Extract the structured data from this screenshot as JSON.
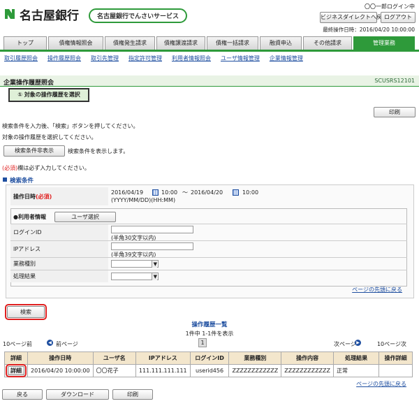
{
  "header": {
    "bank_name": "名古屋銀行",
    "service_name": "名古屋銀行でんさいサービス",
    "user_status": "〇〇一郎ログイン中",
    "direct_button": "ビジネスダイレクトへ戻る",
    "logout_button": "ログアウト",
    "last_operation": "最終操作日時：2016/04/20 10:00:00"
  },
  "tabs": [
    "トップ",
    "債権情報照会",
    "債権発生請求",
    "債権譲渡請求",
    "債権一括請求",
    "融資申込",
    "その他請求",
    "管理業務"
  ],
  "subnav": [
    "取引履歴照会",
    "操作履歴照会",
    "取引先管理",
    "指定許可管理",
    "利用者情報照会",
    "ユーザ情報管理",
    "企業情報管理"
  ],
  "page": {
    "title": "企業操作履歴照会",
    "screen_id": "SCUSRS12101",
    "step": "① 対象の操作履歴を選択",
    "print_label": "印刷",
    "instruction1": "検索条件を入力後、「検索」ボタンを押してください。",
    "instruction2": "対象の操作履歴を選択してください。",
    "toggle_button": "検索条件非表示",
    "toggle_note": "検索条件を表示します。",
    "required_marker": "(必須)",
    "required_note": "欄は必ず入力してください。"
  },
  "search": {
    "section_title": "検索条件",
    "datetime_label": "操作日時",
    "required": "(必須)",
    "from_date": "2016/04/19",
    "from_time": "10:00",
    "tilde": "〜",
    "to_date": "2016/04/20",
    "to_time": "10:00",
    "format_hint": "(YYYY/MM/DD)(HH:MM)",
    "user_info_label": "●利用者情報",
    "user_select_button": "ユーザ選択",
    "login_id_label": "ログインID",
    "login_id_hint": "(半角30文字以内)",
    "ip_label": "IPアドレス",
    "ip_hint": "(半角39文字以内)",
    "business_type_label": "業務種別",
    "result_label": "処理結果",
    "page_top_link": "ページの先頭に戻る",
    "search_button": "検索"
  },
  "results": {
    "title": "操作履歴一覧",
    "count_text": "1件中 1-1件を表示",
    "prev10": "10ページ前",
    "prev": "前ページ",
    "page_num": "1",
    "next": "次ページ",
    "next10": "10ページ次",
    "columns": [
      "詳細",
      "操作日時",
      "ユーザ名",
      "IPアドレス",
      "ログインID",
      "業務種別",
      "操作内容",
      "処理結果",
      "操作詳細"
    ],
    "rows": [
      {
        "detail": "詳細",
        "datetime": "2016/04/20 10:00:00",
        "user": "〇〇花子",
        "ip": "111.111.111.111",
        "login": "userid456",
        "type": "ZZZZZZZZZZZZ",
        "content": "ZZZZZZZZZZZZ",
        "result": "正常",
        "extra": ""
      }
    ],
    "page_top_link": "ページの先頭に戻る"
  },
  "footer": {
    "back": "戻る",
    "download": "ダウンロード",
    "print": "印刷"
  },
  "colors": {
    "brand_green": "#2e9a3a",
    "highlight_red": "#e02020",
    "header_beige": "#f3e6cc"
  }
}
